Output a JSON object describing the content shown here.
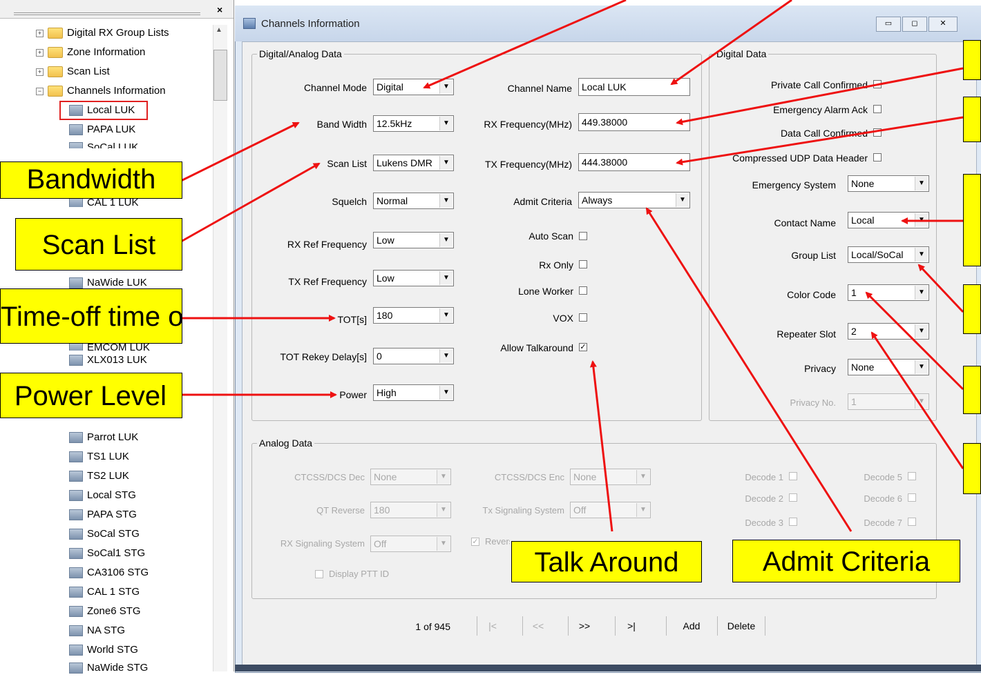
{
  "tree": {
    "close_glyph": "×",
    "items": [
      {
        "label": "Digital RX Group Lists",
        "kind": "folder"
      },
      {
        "label": "Zone Information",
        "kind": "folder"
      },
      {
        "label": "Scan List",
        "kind": "folder"
      },
      {
        "label": "Channels Information",
        "kind": "folder-open"
      },
      {
        "label": "Local LUK",
        "kind": "channel",
        "selected": true
      },
      {
        "label": "PAPA LUK",
        "kind": "channel"
      },
      {
        "label": "SoCal LUK",
        "kind": "channel"
      },
      {
        "label": "CAL 1 LUK",
        "kind": "channel"
      },
      {
        "label": "NaWide LUK",
        "kind": "channel"
      },
      {
        "label": "EMCOM LUK",
        "kind": "channel"
      },
      {
        "label": "XLX013 LUK",
        "kind": "channel"
      },
      {
        "label": "Parrot LUK",
        "kind": "channel"
      },
      {
        "label": "TS1 LUK",
        "kind": "channel"
      },
      {
        "label": "TS2 LUK",
        "kind": "channel"
      },
      {
        "label": "Local STG",
        "kind": "channel"
      },
      {
        "label": "PAPA STG",
        "kind": "channel"
      },
      {
        "label": "SoCal STG",
        "kind": "channel"
      },
      {
        "label": "SoCal1 STG",
        "kind": "channel"
      },
      {
        "label": "CA3106 STG",
        "kind": "channel"
      },
      {
        "label": "CAL 1 STG",
        "kind": "channel"
      },
      {
        "label": "Zone6 STG",
        "kind": "channel"
      },
      {
        "label": "NA STG",
        "kind": "channel"
      },
      {
        "label": "World STG",
        "kind": "channel"
      },
      {
        "label": "NaWide STG",
        "kind": "channel"
      }
    ]
  },
  "window": {
    "title": "Channels Information",
    "controls": {
      "minimize": "▭",
      "maximize": "◻",
      "close": "✕"
    }
  },
  "digital_analog": {
    "group_title": "Digital/Analog Data",
    "channel_mode": {
      "label": "Channel Mode",
      "value": "Digital"
    },
    "band_width": {
      "label": "Band Width",
      "value": "12.5kHz"
    },
    "scan_list": {
      "label": "Scan List",
      "value": "Lukens DMR"
    },
    "squelch": {
      "label": "Squelch",
      "value": "Normal"
    },
    "rx_ref": {
      "label": "RX Ref Frequency",
      "value": "Low"
    },
    "tx_ref": {
      "label": "TX Ref Frequency",
      "value": "Low"
    },
    "tot": {
      "label": "TOT[s]",
      "value": "180"
    },
    "tot_rekey": {
      "label": "TOT Rekey Delay[s]",
      "value": "0"
    },
    "power": {
      "label": "Power",
      "value": "High"
    },
    "channel_name": {
      "label": "Channel Name",
      "value": "Local LUK"
    },
    "rx_freq": {
      "label": "RX Frequency(MHz)",
      "value": "449.38000"
    },
    "tx_freq": {
      "label": "TX Frequency(MHz)",
      "value": "444.38000"
    },
    "admit_criteria": {
      "label": "Admit Criteria",
      "value": "Always"
    },
    "auto_scan": {
      "label": "Auto Scan",
      "checked": false
    },
    "rx_only": {
      "label": "Rx Only",
      "checked": false
    },
    "lone_worker": {
      "label": "Lone Worker",
      "checked": false
    },
    "vox": {
      "label": "VOX",
      "checked": false
    },
    "allow_talkaround": {
      "label": "Allow Talkaround",
      "checked": true
    }
  },
  "digital": {
    "group_title": "Digital Data",
    "private_call_confirmed": {
      "label": "Private Call Confirmed",
      "checked": false
    },
    "emergency_alarm_ack": {
      "label": "Emergency Alarm Ack",
      "checked": false
    },
    "data_call_confirmed": {
      "label": "Data Call Confirmed",
      "checked": false
    },
    "compressed_udp": {
      "label": "Compressed UDP Data Header",
      "checked": false
    },
    "emergency_system": {
      "label": "Emergency System",
      "value": "None"
    },
    "contact_name": {
      "label": "Contact Name",
      "value": "Local"
    },
    "group_list": {
      "label": "Group List",
      "value": "Local/SoCal"
    },
    "color_code": {
      "label": "Color Code",
      "value": "1"
    },
    "repeater_slot": {
      "label": "Repeater Slot",
      "value": "2"
    },
    "privacy": {
      "label": "Privacy",
      "value": "None"
    },
    "privacy_no": {
      "label": "Privacy No.",
      "value": "1"
    }
  },
  "analog": {
    "group_title": "Analog Data",
    "ctcss_dec": {
      "label": "CTCSS/DCS Dec",
      "value": "None"
    },
    "ctcss_enc": {
      "label": "CTCSS/DCS Enc",
      "value": "None"
    },
    "qt_reverse": {
      "label": "QT Reverse",
      "value": "180"
    },
    "tx_signaling": {
      "label": "Tx Signaling System",
      "value": "Off"
    },
    "rx_signaling": {
      "label": "RX Signaling System",
      "value": "Off"
    },
    "reverse_burst": {
      "label": "Reverse Burst",
      "checked": true
    },
    "display_ptt_id": {
      "label": "Display PTT ID",
      "checked": false
    },
    "decode1": {
      "label": "Decode 1"
    },
    "decode2": {
      "label": "Decode 2"
    },
    "decode3": {
      "label": "Decode 3"
    },
    "decode5": {
      "label": "Decode 5"
    },
    "decode6": {
      "label": "Decode 6"
    },
    "decode7": {
      "label": "Decode 7"
    }
  },
  "nav": {
    "counter": "1 of 945",
    "first": "|<",
    "prev": "<<",
    "next": ">>",
    "last": ">|",
    "add": "Add",
    "delete": "Delete"
  },
  "callouts": {
    "bandwidth": "Bandwidth",
    "scan_list": "Scan List",
    "tot": "Time-off time out",
    "power": "Power Level",
    "talk_around": "Talk Around",
    "admit_criteria": "Admit Criteria"
  },
  "colors": {
    "callout_bg": "#ffff00",
    "arrow": "#ee1111",
    "selection_box": "#e02020"
  }
}
